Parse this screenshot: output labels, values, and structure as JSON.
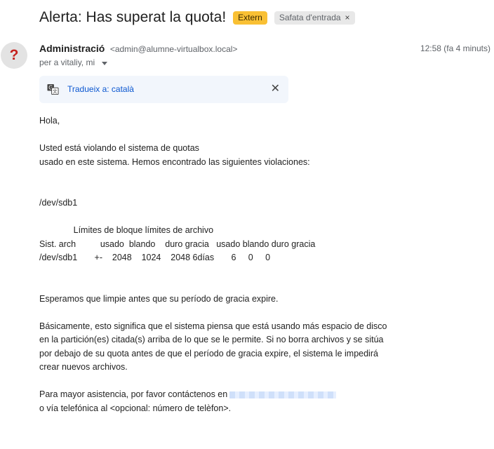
{
  "subject": {
    "title": "Alerta: Has superat la quota!",
    "badge_extern": "Extern",
    "badge_inbox": "Safata d'entrada",
    "badge_inbox_close": "×"
  },
  "sender": {
    "avatar_letter": "?",
    "name": "Administració",
    "email": "<admin@alumne-virtualbox.local>",
    "time": "12:58 (fa 4 minuts)",
    "recipients": "per a vitaliy, mi"
  },
  "translate": {
    "link": "Tradueix a: català",
    "close": "✕"
  },
  "body": {
    "greeting": "Hola,",
    "p1_line1": "Usted está violando el sistema de quotas",
    "p1_line2": "usado en este sistema. Hemos encontrado las siguientes violaciones:",
    "device": "/dev/sdb1",
    "quota_header": "              Límites de bloque límites de archivo",
    "quota_cols": "Sist. arch          usado  blando    duro gracia   usado blando duro gracia",
    "quota_row": "/dev/sdb1       +-    2048    1024    2048 6días       6     0     0",
    "p2": "Esperamos que limpie antes que su período de gracia expire.",
    "p3_line1": "Básicamente, esto significa que el sistema piensa que está usando más espacio de disco",
    "p3_line2": "en la partición(es) citada(s) arriba de lo que se le permite. Si no borra archivos y se sitúa",
    "p3_line3": "por debajo de su quota antes de que el período de gracia expire, el sistema le impedirá",
    "p3_line4": "crear nuevos archivos.",
    "p4_line1": "Para mayor asistencia, por favor contáctenos en",
    "p4_line2": "o vía telefónica al <opcional: número de telèfon>."
  },
  "colors": {
    "extern_badge": "#f9c034",
    "link": "#0b57d0",
    "avatar_mark": "#c5221f"
  }
}
